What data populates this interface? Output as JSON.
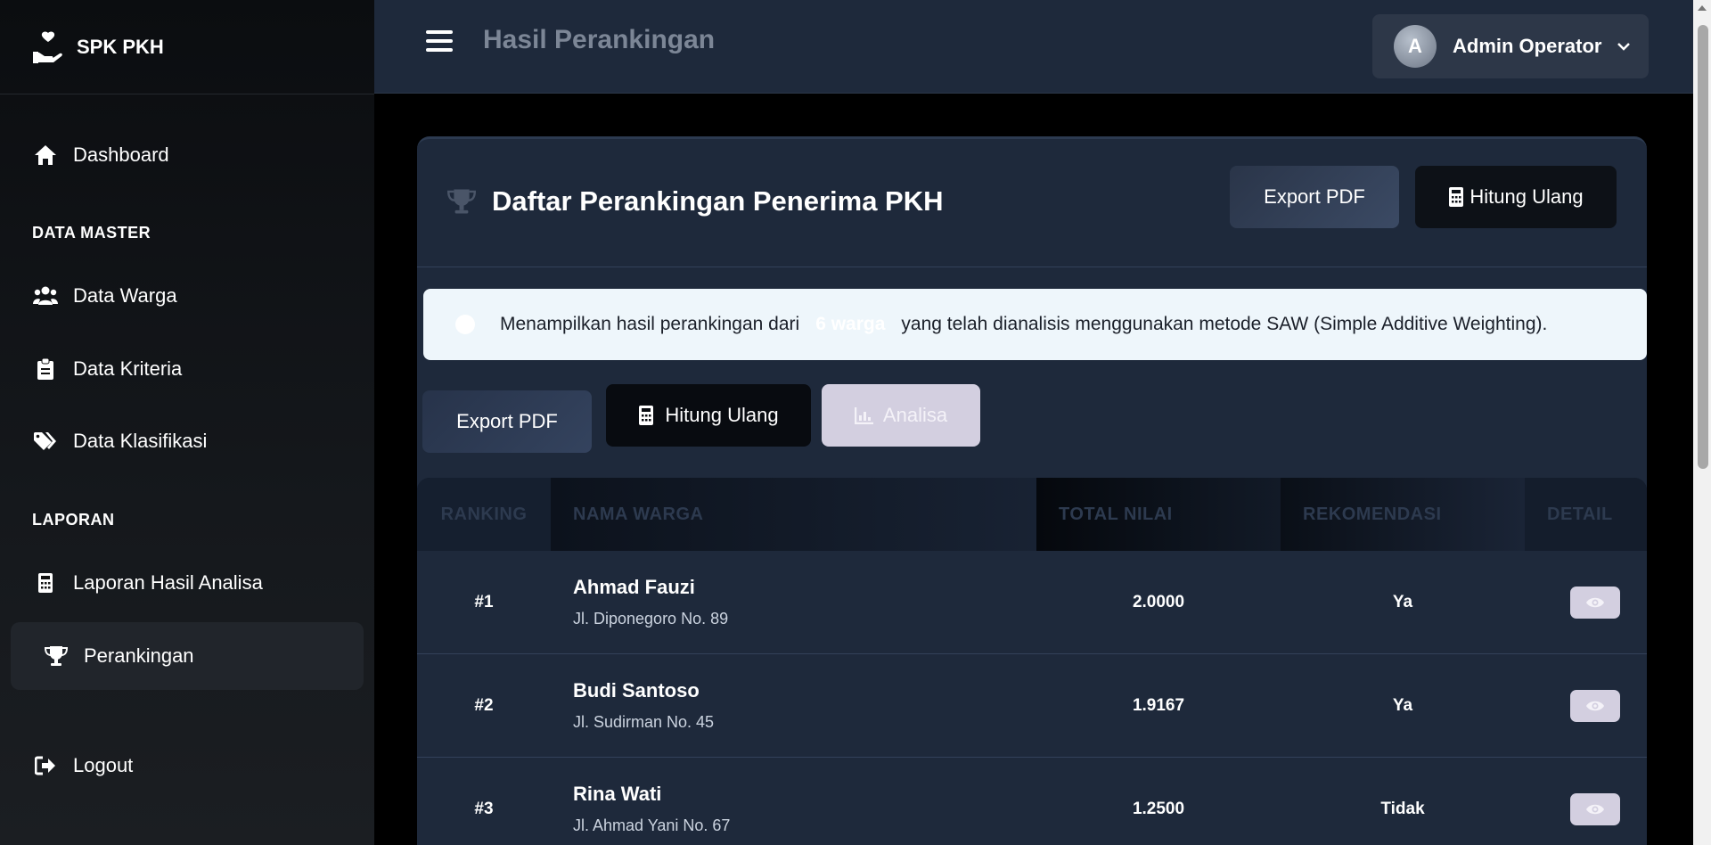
{
  "brand": {
    "name": "SPK PKH"
  },
  "sidebar": {
    "items": [
      {
        "label": "Dashboard",
        "icon": "home-icon"
      },
      {
        "label": "Data Warga",
        "icon": "users-icon"
      },
      {
        "label": "Data Kriteria",
        "icon": "clipboard-icon"
      },
      {
        "label": "Data Klasifikasi",
        "icon": "tags-icon"
      },
      {
        "label": "Laporan Hasil Analisa",
        "icon": "calculator-icon"
      },
      {
        "label": "Perankingan",
        "icon": "trophy-icon",
        "active": true
      },
      {
        "label": "Logout",
        "icon": "logout-icon"
      }
    ],
    "sections": {
      "master": "DATA MASTER",
      "laporan": "LAPORAN"
    }
  },
  "header": {
    "title": "Hasil Perankingan",
    "user": {
      "initial": "A",
      "name": "Admin Operator"
    }
  },
  "card": {
    "title": "Daftar Perankingan Penerima PKH",
    "export_label": "Export PDF",
    "hitung_label": "Hitung Ulang"
  },
  "alert": {
    "prefix": "Menampilkan hasil perankingan dari",
    "count": "6 warga",
    "suffix": "yang telah dianalisis menggunakan metode SAW (Simple Additive Weighting)."
  },
  "actions": {
    "export_label": "Export PDF",
    "hitung_label": "Hitung Ulang",
    "analisa_label": "Analisa"
  },
  "table": {
    "headers": {
      "rank": "RANKING",
      "nama": "NAMA WARGA",
      "total": "TOTAL NILAI",
      "rek": "REKOMENDASI",
      "detail": "DETAIL"
    },
    "rows": [
      {
        "rank": "#1",
        "nama": "Ahmad Fauzi",
        "alamat": "Jl. Diponegoro No. 89",
        "total": "2.0000",
        "rek": "Ya"
      },
      {
        "rank": "#2",
        "nama": "Budi Santoso",
        "alamat": "Jl. Sudirman No. 45",
        "total": "1.9167",
        "rek": "Ya"
      },
      {
        "rank": "#3",
        "nama": "Rina Wati",
        "alamat": "Jl. Ahmad Yani No. 67",
        "total": "1.2500",
        "rek": "Tidak"
      }
    ]
  },
  "colors": {
    "sidebar_bg": "#111418",
    "topbar_bg": "#1e293b",
    "card_bg": "#1e293b",
    "alert_bg": "#eef6fb",
    "accent_light": "#d3cfe0"
  }
}
